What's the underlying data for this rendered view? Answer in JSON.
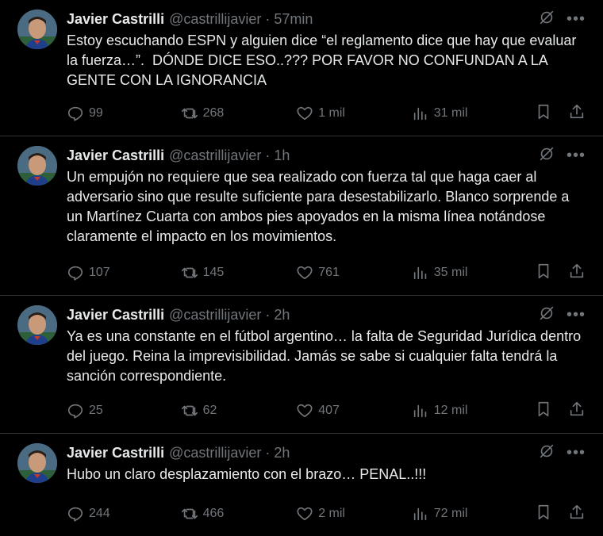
{
  "author": {
    "name": "Javier Castrilli",
    "handle": "@castrillijavier",
    "separator": "·"
  },
  "tweets": [
    {
      "time": "57min",
      "text": "Estoy escuchando ESPN y alguien dice “el reglamento dice que hay que evaluar la fuerza…”.  DÓNDE DICE ESO..??? POR FAVOR NO CONFUNDAN A LA GENTE CON LA IGNORANCIA",
      "replies": "99",
      "retweets": "268",
      "likes": "1 mil",
      "views": "31 mil"
    },
    {
      "time": "1h",
      "text": "Un empujón no requiere que sea realizado con fuerza tal que haga caer al adversario sino que resulte suficiente para desestabilizarlo. Blanco sorprende a un Martínez Cuarta con ambos pies apoyados en la misma línea notándose claramente el impacto en los movimientos.",
      "replies": "107",
      "retweets": "145",
      "likes": "761",
      "views": "35 mil"
    },
    {
      "time": "2h",
      "text": "Ya es una constante en el fútbol argentino… la falta de Seguridad Jurídica dentro del juego. Reina la imprevisibilidad. Jamás se sabe si cualquier falta tendrá la sanción correspondiente.",
      "replies": "25",
      "retweets": "62",
      "likes": "407",
      "views": "12 mil"
    },
    {
      "time": "2h",
      "text": "Hubo un claro desplazamiento con el brazo… PENAL..!!!",
      "replies": "244",
      "retweets": "466",
      "likes": "2 mil",
      "views": "72 mil"
    }
  ],
  "icons": {
    "grok": "grok-icon",
    "more": "more-icon",
    "reply": "reply-icon",
    "retweet": "retweet-icon",
    "like": "like-icon",
    "views": "views-icon",
    "bookmark": "bookmark-icon",
    "share": "share-icon"
  },
  "colors": {
    "background": "#000000",
    "text": "#e7e9ea",
    "muted": "#71767b",
    "divider": "#2f3336"
  }
}
